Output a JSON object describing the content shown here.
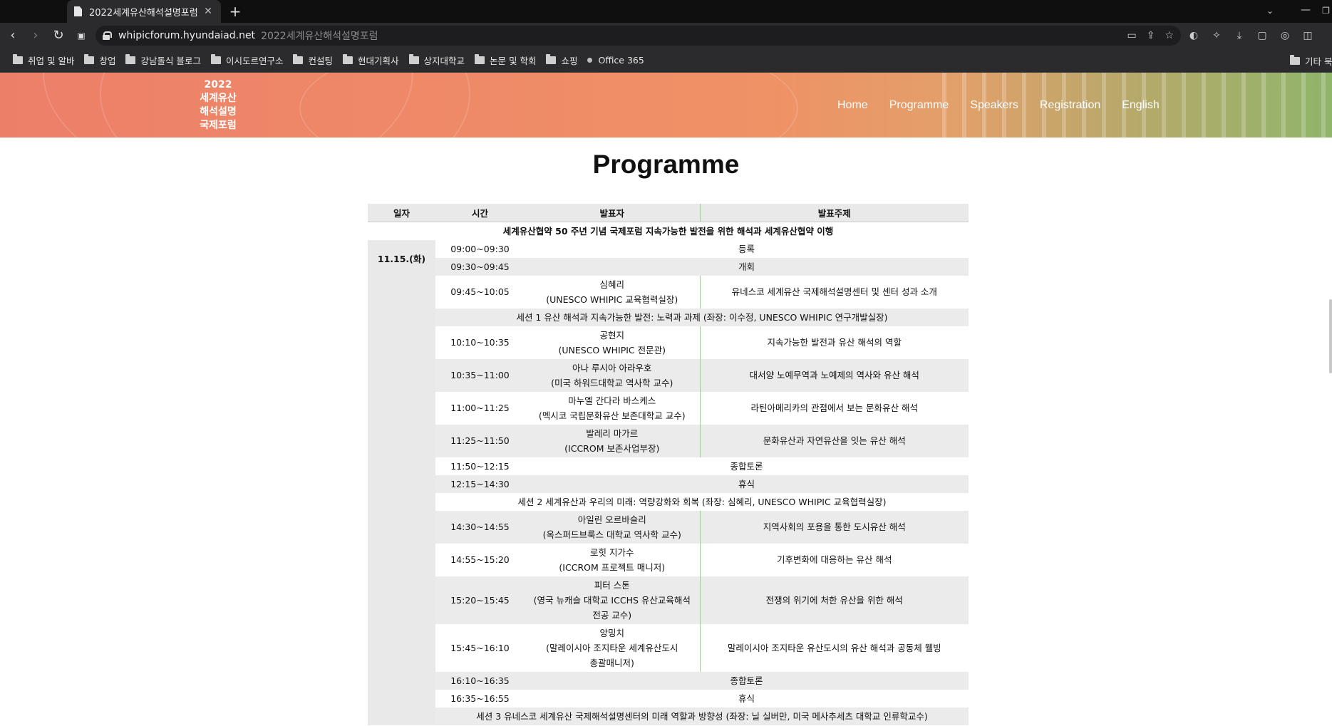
{
  "browser": {
    "ghost_tab_title": "",
    "active_tab_title": "2022세계유산해석설명포럼",
    "tab_close": "✕",
    "new_tab": "+",
    "url_host": "whipicforum.hyundaiad.net",
    "url_page_title": "2022세계유산해석설명포럼",
    "bookmarks": [
      {
        "label": "취업 및 알바",
        "icon": "folder-icon"
      },
      {
        "label": "창업",
        "icon": "folder-icon"
      },
      {
        "label": "강남돌식 블로그",
        "icon": "folder-icon"
      },
      {
        "label": "이시도르연구소",
        "icon": "folder-icon"
      },
      {
        "label": "컨설팅",
        "icon": "folder-icon"
      },
      {
        "label": "현대기획사",
        "icon": "folder-icon"
      },
      {
        "label": "상지대학교",
        "icon": "folder-icon"
      },
      {
        "label": "논문 및 학회",
        "icon": "folder-icon"
      },
      {
        "label": "쇼핑",
        "icon": "folder-icon"
      },
      {
        "label": "Office 365",
        "icon": "dot-icon"
      }
    ],
    "bookmarks_overflow": "기타 북"
  },
  "site": {
    "logo_lines": [
      "2022",
      "세계유산",
      "해석설명",
      "국제포럼"
    ],
    "nav": [
      "Home",
      "Programme",
      "Speakers",
      "Registration",
      "English"
    ]
  },
  "page": {
    "title": "Programme"
  },
  "programme": {
    "headers": {
      "date": "일자",
      "time": "시간",
      "speaker": "발표자",
      "topic": "발표주제"
    },
    "date": "11.15.(화)",
    "event_title": "세계유산협약 50 주년 기념 국제포럼 지속가능한 발전을 위한 해석과 세계유산협약 이행",
    "rows": [
      {
        "kind": "merged",
        "time": "09:00~09:30",
        "text": "등록",
        "shade": false
      },
      {
        "kind": "merged",
        "time": "09:30~09:45",
        "text": "개회",
        "shade": true
      },
      {
        "kind": "talk",
        "time": "09:45~10:05",
        "speaker": [
          "심혜리",
          "(UNESCO WHIPIC 교육협력실장)"
        ],
        "topic": "유네스코 세계유산 국제해석설명센터 및 센터 성과 소개",
        "shade": false
      },
      {
        "kind": "session",
        "text": "세션 1 유산 해석과 지속가능한 발전: 노력과 과제 (좌장: 이수정, UNESCO WHIPIC 연구개발실장)",
        "shade": true
      },
      {
        "kind": "talk",
        "time": "10:10~10:35",
        "speaker": [
          "공현지",
          "(UNESCO WHIPIC 전문관)"
        ],
        "topic": "지속가능한 발전과 유산 해석의 역할",
        "shade": false
      },
      {
        "kind": "talk",
        "time": "10:35~11:00",
        "speaker": [
          "아나 루시아 아라우호",
          "(미국 하워드대학교 역사학 교수)"
        ],
        "topic": "대서양 노예무역과 노예제의 역사와 유산 해석",
        "shade": true
      },
      {
        "kind": "talk",
        "time": "11:00~11:25",
        "speaker": [
          "마누엘 간다라 바스케스",
          "(멕시코 국립문화유산 보존대학교 교수)"
        ],
        "topic": "라틴아메리카의 관점에서 보는 문화유산 해석",
        "shade": false
      },
      {
        "kind": "talk",
        "time": "11:25~11:50",
        "speaker": [
          "발레리 마가르",
          "(ICCROM 보존사업부장)"
        ],
        "topic": "문화유산과 자연유산을 잇는 유산 해석",
        "shade": true
      },
      {
        "kind": "merged",
        "time": "11:50~12:15",
        "text": "종합토론",
        "shade": false
      },
      {
        "kind": "merged",
        "time": "12:15~14:30",
        "text": "휴식",
        "shade": true
      },
      {
        "kind": "session",
        "text": "세션 2 세계유산과 우리의 미래: 역량강화와 회복 (좌장: 심혜리, UNESCO WHIPIC 교육협력실장)",
        "shade": false
      },
      {
        "kind": "talk",
        "time": "14:30~14:55",
        "speaker": [
          "아일린 오르바슬리",
          "(옥스퍼드브룩스 대학교 역사학 교수)"
        ],
        "topic": "지역사회의 포용을 통한 도시유산 해석",
        "shade": true
      },
      {
        "kind": "talk",
        "time": "14:55~15:20",
        "speaker": [
          "로힛 지가수",
          "(ICCROM 프로젝트 매니저)"
        ],
        "topic": "기후변화에 대응하는 유산 해석",
        "shade": false
      },
      {
        "kind": "talk",
        "time": "15:20~15:45",
        "speaker": [
          "피터 스톤",
          "(영국 뉴캐슬 대학교 ICCHS 유산교육해석",
          "전공 교수)"
        ],
        "topic": "전쟁의 위기에 처한 유산을 위한 해석",
        "shade": true
      },
      {
        "kind": "talk",
        "time": "15:45~16:10",
        "speaker": [
          "앙밍치",
          "(말레이시아 조지타운 세계유산도시",
          "총괄매니저)"
        ],
        "topic": "말레이시아 조지타운 유산도시의 유산 해석과 공동체 웰빙",
        "shade": false
      },
      {
        "kind": "merged",
        "time": "16:10~16:35",
        "text": "종합토론",
        "shade": true
      },
      {
        "kind": "merged",
        "time": "16:35~16:55",
        "text": "휴식",
        "shade": false
      },
      {
        "kind": "session",
        "text": "세션 3 유네스코 세계유산 국제해석설명센터의 미래 역할과 방향성 (좌장: 닐 실버만, 미국 메사추세츠 대학교 인류학교수)",
        "shade": true
      }
    ]
  }
}
